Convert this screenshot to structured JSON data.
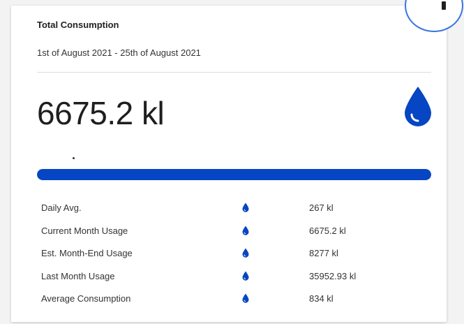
{
  "card": {
    "title": "Total Consumption",
    "date_range": "1st of August 2021 - 25th of August 2021",
    "total_value": "6675.2 kl",
    "progress_percent": 100
  },
  "stats": [
    {
      "label": "Daily Avg.",
      "value": "267 kl"
    },
    {
      "label": "Current Month Usage",
      "value": "6675.2 kl"
    },
    {
      "label": "Est. Month-End Usage",
      "value": "8277 kl"
    },
    {
      "label": "Last Month Usage",
      "value": "35952.93 kl"
    },
    {
      "label": "Average Consumption",
      "value": "834 kl"
    }
  ],
  "colors": {
    "accent": "#0645c3",
    "drop": "#0645c3",
    "outline": "#3a73e0"
  },
  "icons": {
    "main": "water-drop-icon",
    "row": "water-drop-icon",
    "corner": "corner-button-icon"
  }
}
